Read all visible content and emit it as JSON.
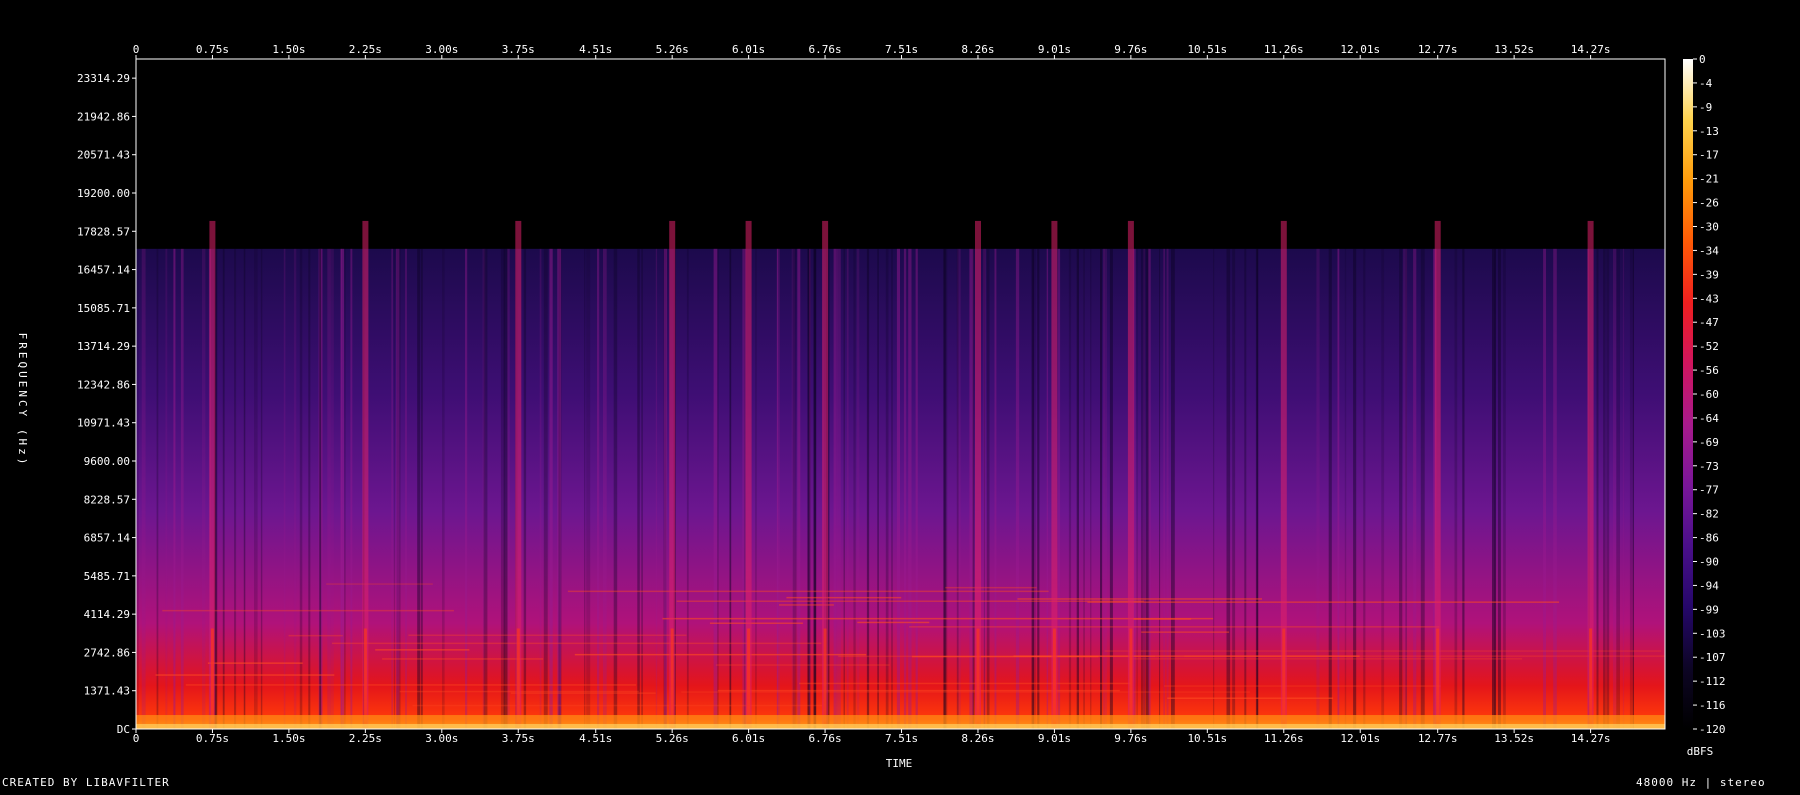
{
  "footer": {
    "credit": "CREATED BY LIBAVFILTER",
    "format": "48000 Hz | stereo"
  },
  "chart_data": {
    "type": "heatmap",
    "title": "",
    "xlabel": "TIME",
    "ylabel": "FREQUENCY (Hz)",
    "colorbar_label": "dBFS",
    "x_unit": "s",
    "xlim": [
      0,
      15.0
    ],
    "ylim": [
      0,
      24000
    ],
    "colorbar_range": [
      -120,
      0
    ],
    "x_ticks": [
      {
        "v": 0,
        "label": "0"
      },
      {
        "v": 0.75,
        "label": "0.75s"
      },
      {
        "v": 1.5,
        "label": "1.50s"
      },
      {
        "v": 2.25,
        "label": "2.25s"
      },
      {
        "v": 3.0,
        "label": "3.00s"
      },
      {
        "v": 3.75,
        "label": "3.75s"
      },
      {
        "v": 4.51,
        "label": "4.51s"
      },
      {
        "v": 5.26,
        "label": "5.26s"
      },
      {
        "v": 6.01,
        "label": "6.01s"
      },
      {
        "v": 6.76,
        "label": "6.76s"
      },
      {
        "v": 7.51,
        "label": "7.51s"
      },
      {
        "v": 8.26,
        "label": "8.26s"
      },
      {
        "v": 9.01,
        "label": "9.01s"
      },
      {
        "v": 9.76,
        "label": "9.76s"
      },
      {
        "v": 10.51,
        "label": "10.51s"
      },
      {
        "v": 11.26,
        "label": "11.26s"
      },
      {
        "v": 12.01,
        "label": "12.01s"
      },
      {
        "v": 12.77,
        "label": "12.77s"
      },
      {
        "v": 13.52,
        "label": "13.52s"
      },
      {
        "v": 14.27,
        "label": "14.27s"
      }
    ],
    "y_ticks": [
      {
        "v": 0,
        "label": "DC"
      },
      {
        "v": 1371.43,
        "label": "1371.43"
      },
      {
        "v": 2742.86,
        "label": "2742.86"
      },
      {
        "v": 4114.29,
        "label": "4114.29"
      },
      {
        "v": 5485.71,
        "label": "5485.71"
      },
      {
        "v": 6857.14,
        "label": "6857.14"
      },
      {
        "v": 8228.57,
        "label": "8228.57"
      },
      {
        "v": 9600.0,
        "label": "9600.00"
      },
      {
        "v": 10971.43,
        "label": "10971.43"
      },
      {
        "v": 12342.86,
        "label": "12342.86"
      },
      {
        "v": 13714.29,
        "label": "13714.29"
      },
      {
        "v": 15085.71,
        "label": "15085.71"
      },
      {
        "v": 16457.14,
        "label": "16457.14"
      },
      {
        "v": 17828.57,
        "label": "17828.57"
      },
      {
        "v": 19200.0,
        "label": "19200.00"
      },
      {
        "v": 20571.43,
        "label": "20571.43"
      },
      {
        "v": 21942.86,
        "label": "21942.86"
      },
      {
        "v": 23314.29,
        "label": "23314.29"
      }
    ],
    "colorbar_ticks": [
      "0",
      "-4",
      "-9",
      "-13",
      "-17",
      "-21",
      "-26",
      "-30",
      "-34",
      "-39",
      "-43",
      "-47",
      "-52",
      "-56",
      "-60",
      "-64",
      "-69",
      "-73",
      "-77",
      "-82",
      "-86",
      "-90",
      "-94",
      "-99",
      "-103",
      "-107",
      "-112",
      "-116",
      "-120"
    ],
    "colormap": [
      "#000000",
      "#0d0525",
      "#25076a",
      "#4a0f8a",
      "#7a1699",
      "#a71a8c",
      "#d0155e",
      "#ef1f1f",
      "#ff5a06",
      "#ff9b0a",
      "#ffd34d",
      "#ffffff"
    ],
    "spectrum": {
      "cutoff_hz": 17200,
      "onsets_s": [
        0.75,
        2.25,
        3.75,
        5.26,
        6.01,
        6.76,
        8.26,
        9.01,
        9.76,
        11.26,
        12.77,
        14.27
      ]
    }
  }
}
